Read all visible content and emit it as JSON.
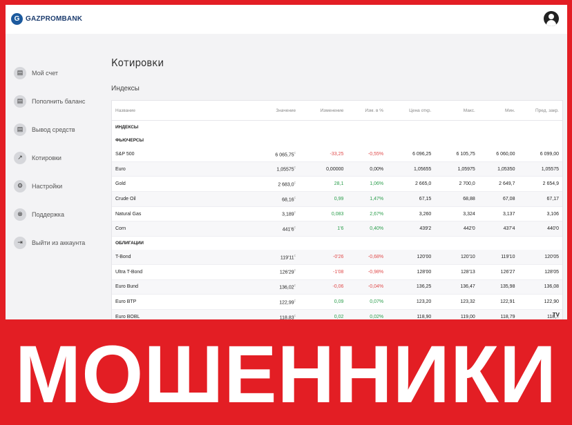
{
  "header": {
    "logo_text": "GAZPROMBANK",
    "logo_icon": "gazprombank-logo-icon",
    "avatar_icon": "user-avatar-icon"
  },
  "sidebar": {
    "items": [
      {
        "label": "Мой счет",
        "icon": "account-icon"
      },
      {
        "label": "Пополнить баланс",
        "icon": "deposit-icon"
      },
      {
        "label": "Вывод средств",
        "icon": "withdraw-icon"
      },
      {
        "label": "Котировки",
        "icon": "chart-icon"
      },
      {
        "label": "Настройки",
        "icon": "gear-icon"
      },
      {
        "label": "Поддержка",
        "icon": "support-icon"
      },
      {
        "label": "Выйти из аккаунта",
        "icon": "logout-icon"
      }
    ]
  },
  "main": {
    "title": "Котировки",
    "section": "Индексы",
    "columns": [
      "Название",
      "Значение",
      "Изменение",
      "Изм. в %",
      "Цена откр.",
      "Макс.",
      "Мин.",
      "Пред. закр."
    ],
    "groups": [
      {
        "label": "ИНДЕКСЫ",
        "rows": []
      },
      {
        "label": "ФЬЮЧЕРСЫ",
        "rows": [
          {
            "name": "S&P 500",
            "value": "6 065,75",
            "change": "-33,25",
            "pct": "-0,55%",
            "open": "6 096,25",
            "high": "6 105,75",
            "low": "6 060,00",
            "prev": "6 099,00",
            "dir": "neg"
          },
          {
            "name": "Euro",
            "value": "1,05575",
            "change": "0,00000",
            "pct": "0,00%",
            "open": "1,05655",
            "high": "1,05975",
            "low": "1,05350",
            "prev": "1,05575",
            "dir": "flat"
          },
          {
            "name": "Gold",
            "value": "2 683,0",
            "change": "28,1",
            "pct": "1,06%",
            "open": "2 665,0",
            "high": "2 700,0",
            "low": "2 649,7",
            "prev": "2 654,9",
            "dir": "pos"
          },
          {
            "name": "Crude Oil",
            "value": "68,16",
            "change": "0,99",
            "pct": "1,47%",
            "open": "67,15",
            "high": "68,88",
            "low": "67,08",
            "prev": "67,17",
            "dir": "pos"
          },
          {
            "name": "Natural Gas",
            "value": "3,189",
            "change": "0,083",
            "pct": "2,67%",
            "open": "3,260",
            "high": "3,324",
            "low": "3,137",
            "prev": "3,106",
            "dir": "pos"
          },
          {
            "name": "Corn",
            "value": "441'6",
            "change": "1'6",
            "pct": "0,40%",
            "open": "439'2",
            "high": "442'0",
            "low": "437'4",
            "prev": "440'0",
            "dir": "pos"
          }
        ]
      },
      {
        "label": "ОБЛИГАЦИИ",
        "rows": [
          {
            "name": "T-Bond",
            "value": "119'11",
            "change": "-0'26",
            "pct": "-0,68%",
            "open": "120'00",
            "high": "120'10",
            "low": "119'10",
            "prev": "120'05",
            "dir": "neg"
          },
          {
            "name": "Ultra T-Bond",
            "value": "126'29",
            "change": "-1'08",
            "pct": "-0,98%",
            "open": "128'00",
            "high": "128'13",
            "low": "126'27",
            "prev": "128'05",
            "dir": "neg"
          },
          {
            "name": "Euro Bund",
            "value": "136,02",
            "change": "-0,06",
            "pct": "-0,04%",
            "open": "136,25",
            "high": "136,47",
            "low": "135,98",
            "prev": "136,08",
            "dir": "neg"
          },
          {
            "name": "Euro BTP",
            "value": "122,99",
            "change": "0,09",
            "pct": "0,07%",
            "open": "123,20",
            "high": "123,32",
            "low": "122,91",
            "prev": "122,90",
            "dir": "pos"
          },
          {
            "name": "Euro BOBL",
            "value": "118,83",
            "change": "0,02",
            "pct": "0,02%",
            "open": "118,90",
            "high": "119,00",
            "low": "118,79",
            "prev": "118,..",
            "dir": "pos"
          }
        ]
      }
    ],
    "value_suffix": "c"
  },
  "banner": {
    "text": "МОШЕННИКИ"
  },
  "colors": {
    "banner_red": "#e31e24",
    "negative": "#e04b4b",
    "positive": "#2a9d4b"
  }
}
